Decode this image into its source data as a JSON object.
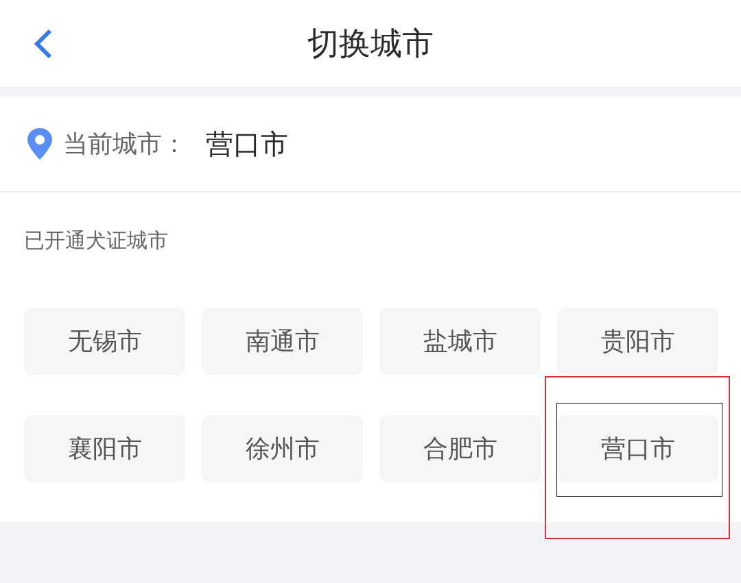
{
  "header": {
    "title": "切换城市"
  },
  "current_city": {
    "label": "当前城市：",
    "value": "营口市"
  },
  "section": {
    "title": "已开通犬证城市"
  },
  "cities": [
    {
      "name": "无锡市"
    },
    {
      "name": "南通市"
    },
    {
      "name": "盐城市"
    },
    {
      "name": "贵阳市"
    },
    {
      "name": "襄阳市"
    },
    {
      "name": "徐州市"
    },
    {
      "name": "合肥市"
    },
    {
      "name": "营口市"
    }
  ]
}
